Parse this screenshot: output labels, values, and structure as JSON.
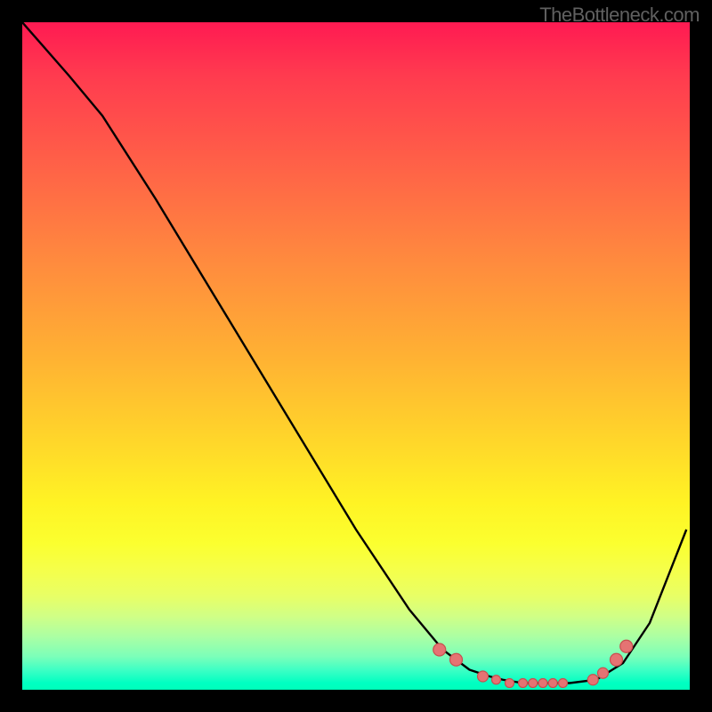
{
  "watermark": "TheBottleneck.com",
  "chart_data": {
    "type": "line",
    "title": "",
    "xlabel": "",
    "ylabel": "",
    "xlim": [
      0,
      100
    ],
    "ylim": [
      0,
      100
    ],
    "series": [
      {
        "name": "bottleneck-curve",
        "x": [
          0,
          7,
          12,
          20,
          30,
          40,
          50,
          58,
          63,
          67,
          70,
          72,
          75,
          78,
          82,
          86,
          90,
          94,
          99.5
        ],
        "y": [
          100,
          92,
          86,
          73.5,
          57,
          40.5,
          24,
          12,
          6,
          3,
          2,
          1.5,
          1,
          1,
          1,
          1.5,
          4,
          10,
          24
        ]
      }
    ],
    "markers": {
      "name": "highlight-dots",
      "x": [
        62.5,
        65,
        69,
        71,
        73,
        75,
        76.5,
        78,
        79.5,
        81,
        85.5,
        87,
        89,
        90.5
      ],
      "y": [
        6,
        4.5,
        2,
        1.5,
        1,
        1,
        1,
        1,
        1,
        1,
        1.5,
        2.5,
        4.5,
        6.5
      ],
      "r": [
        7,
        7,
        6,
        5,
        5,
        5,
        5,
        5,
        5,
        5,
        6,
        6,
        7,
        7
      ]
    },
    "gradient_stops": [
      {
        "pct": 0,
        "color": "#ff1a52"
      },
      {
        "pct": 8,
        "color": "#ff3b4f"
      },
      {
        "pct": 22,
        "color": "#ff6347"
      },
      {
        "pct": 36,
        "color": "#ff8b3e"
      },
      {
        "pct": 50,
        "color": "#ffb133"
      },
      {
        "pct": 63,
        "color": "#ffd72a"
      },
      {
        "pct": 72,
        "color": "#fff324"
      },
      {
        "pct": 78,
        "color": "#fbff2f"
      },
      {
        "pct": 82,
        "color": "#f5ff4a"
      },
      {
        "pct": 86,
        "color": "#e8ff66"
      },
      {
        "pct": 89,
        "color": "#d0ff86"
      },
      {
        "pct": 92,
        "color": "#acffa3"
      },
      {
        "pct": 95,
        "color": "#7cffb9"
      },
      {
        "pct": 97,
        "color": "#3fffc4"
      },
      {
        "pct": 99,
        "color": "#00ffc2"
      },
      {
        "pct": 100,
        "color": "#00ffba"
      }
    ]
  }
}
